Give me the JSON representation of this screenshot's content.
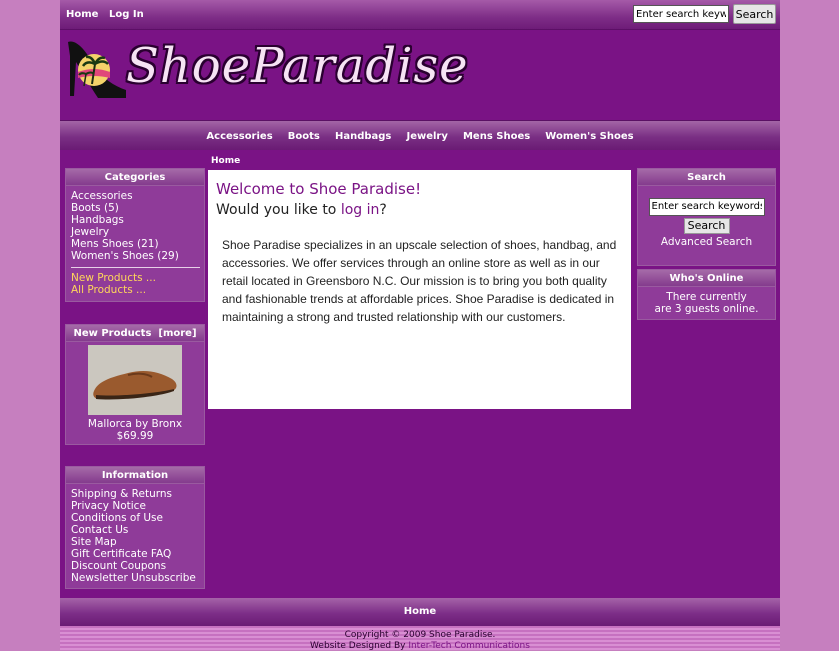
{
  "top_nav": {
    "home": "Home",
    "login": "Log In"
  },
  "top_search": {
    "value": "Enter search keywords",
    "button": "Search"
  },
  "logo": {
    "text": "ShoeParadise"
  },
  "category_nav": [
    "Accessories",
    "Boots",
    "Handbags",
    "Jewelry",
    "Mens Shoes",
    "Women's Shoes"
  ],
  "categories_box": {
    "title": "Categories",
    "items": [
      "Accessories",
      "Boots (5)",
      "Handbags",
      "Jewelry",
      "Mens Shoes (21)",
      "Women's Shoes (29)"
    ],
    "new_products": "New Products ...",
    "all_products": "All Products ..."
  },
  "new_products_box": {
    "title": "New Products",
    "more": "[more]",
    "product_name": "Mallorca by Bronx",
    "product_price": "$69.99"
  },
  "information_box": {
    "title": "Information",
    "items": [
      "Shipping & Returns",
      "Privacy Notice",
      "Conditions of Use",
      "Contact Us",
      "Site Map",
      "Gift Certificate FAQ",
      "Discount Coupons",
      "Newsletter Unsubscribe"
    ]
  },
  "breadcrumb": "Home",
  "main": {
    "welcome": "Welcome to Shoe Paradise!",
    "login_prefix": "Would you like to ",
    "login_link": "log in",
    "login_suffix": "?",
    "mission": "Shoe Paradise specializes in an upscale selection of shoes, handbag, and accessories. We offer services through an online store as well as in our retail located in Greensboro N.C. Our mission is to bring you both quality and fashionable trends at affordable prices. Shoe Paradise is dedicated in maintaining a strong and trusted relationship with our customers."
  },
  "search_box": {
    "title": "Search",
    "input_value": "Enter search keywords here",
    "button": "Search",
    "advanced": "Advanced Search"
  },
  "whos_online_box": {
    "title": "Who's Online",
    "line1": "There currently",
    "line2": "are 3 guests online."
  },
  "footer": {
    "home": "Home",
    "copyright": "Copyright © 2009 Shoe Paradise.",
    "designed_prefix": "Website Designed By ",
    "designed_link": "Inter-Tech Communications"
  },
  "colors": {
    "background": "#c67fbf",
    "main": "#7a1385",
    "link_highlight": "#ffd75a"
  },
  "icons": {
    "logo_image": "high-heel-shoe-palm-tree-logo",
    "product_image": "brown-shoe-photo"
  }
}
